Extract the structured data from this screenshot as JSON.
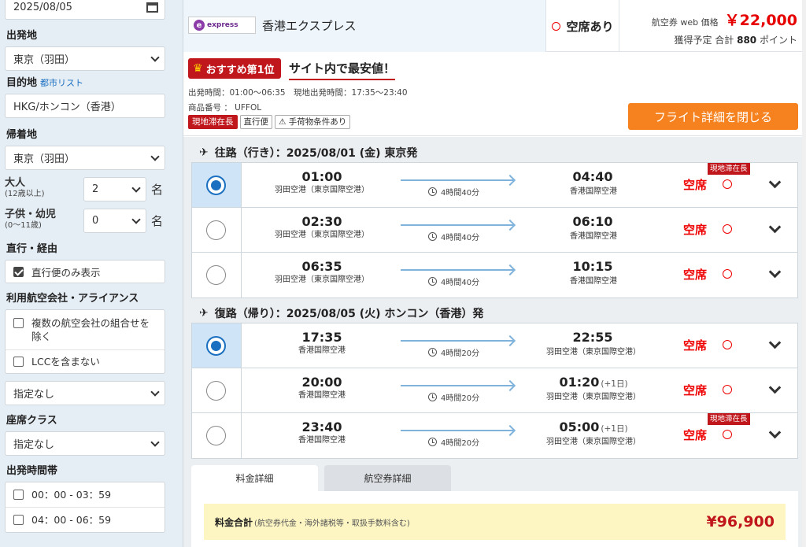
{
  "sidebar": {
    "return_date": "2025/08/05",
    "origin_label": "出発地",
    "origin_value": "東京（羽田）",
    "dest_label": "目的地",
    "dest_link": "都市リスト",
    "dest_value": "HKG/ホンコン（香港）",
    "return_label": "帰着地",
    "return_value": "東京（羽田）",
    "adult_label": "大人",
    "adult_sub": "(12歳以上)",
    "adult_count": "2",
    "child_label": "子供・幼児",
    "child_sub": "(0〜11歳)",
    "child_count": "0",
    "pax_unit": "名",
    "direct_label": "直行・経由",
    "direct_option": "直行便のみ表示",
    "airline_label": "利用航空会社・アライアンス",
    "airline_opt1": "複数の航空会社の組合せを除く",
    "airline_opt2": "LCCを含まない",
    "airline_select": "指定なし",
    "class_label": "座席クラス",
    "class_select": "指定なし",
    "dep_time_label": "出発時間帯",
    "time_opt1": "00：00 - 03：59",
    "time_opt2": "04：00 - 06：59"
  },
  "header": {
    "logo_text": "express",
    "airline_name": "香港エクスプレス",
    "seat_status": "空席あり",
    "price_label": "航空券 web 価格",
    "price": "￥22,000",
    "points_prefix": "獲得予定 合計",
    "points_value": "880",
    "points_suffix": "ポイント"
  },
  "info": {
    "rank_badge": "おすすめ第1位",
    "best_price": "サイト内で最安値！",
    "times": "出発時間：01:00〜06:35　現地出発時間：17:35〜23:40",
    "product_code": "商品番号 ： UFFOL",
    "tag_stay": "現地滞在長",
    "tag_direct": "直行便",
    "tag_baggage": "手荷物条件あり",
    "close_button": "フライト詳細を閉じる"
  },
  "outbound": {
    "title": "往路（行き）：2025/08/01 (金) 東京発",
    "flights": [
      {
        "dep_time": "01:00",
        "dep_airport": "羽田空港（東京国際空港）",
        "duration": "4時間40分",
        "arr_time": "04:40",
        "arr_plus": "",
        "arr_airport": "香港国際空港",
        "seat": "空席",
        "stay_tag": "現地滞在長"
      },
      {
        "dep_time": "02:30",
        "dep_airport": "羽田空港（東京国際空港）",
        "duration": "4時間40分",
        "arr_time": "06:10",
        "arr_plus": "",
        "arr_airport": "香港国際空港",
        "seat": "空席",
        "stay_tag": ""
      },
      {
        "dep_time": "06:35",
        "dep_airport": "羽田空港（東京国際空港）",
        "duration": "4時間40分",
        "arr_time": "10:15",
        "arr_plus": "",
        "arr_airport": "香港国際空港",
        "seat": "空席",
        "stay_tag": ""
      }
    ]
  },
  "inbound": {
    "title": "復路（帰り）：2025/08/05 (火) ホンコン（香港）発",
    "flights": [
      {
        "dep_time": "17:35",
        "dep_airport": "香港国際空港",
        "duration": "4時間20分",
        "arr_time": "22:55",
        "arr_plus": "",
        "arr_airport": "羽田空港（東京国際空港）",
        "seat": "空席",
        "stay_tag": ""
      },
      {
        "dep_time": "20:00",
        "dep_airport": "香港国際空港",
        "duration": "4時間20分",
        "arr_time": "01:20",
        "arr_plus": "(+1日)",
        "arr_airport": "羽田空港（東京国際空港）",
        "seat": "空席",
        "stay_tag": ""
      },
      {
        "dep_time": "23:40",
        "dep_airport": "香港国際空港",
        "duration": "4時間20分",
        "arr_time": "05:00",
        "arr_plus": "(+1日)",
        "arr_airport": "羽田空港（東京国際空港）",
        "seat": "空席",
        "stay_tag": "現地滞在長"
      }
    ]
  },
  "tabs": [
    "料金詳細",
    "航空券詳細"
  ],
  "fare": {
    "label": "料金合計",
    "note": "(航空券代金・海外諸税等・取扱手数料含む)",
    "total": "¥96,900"
  },
  "colors": {
    "accent_red": "#c0171d",
    "orange_button": "#f5821f",
    "selected_blue": "#1a6fc0"
  }
}
